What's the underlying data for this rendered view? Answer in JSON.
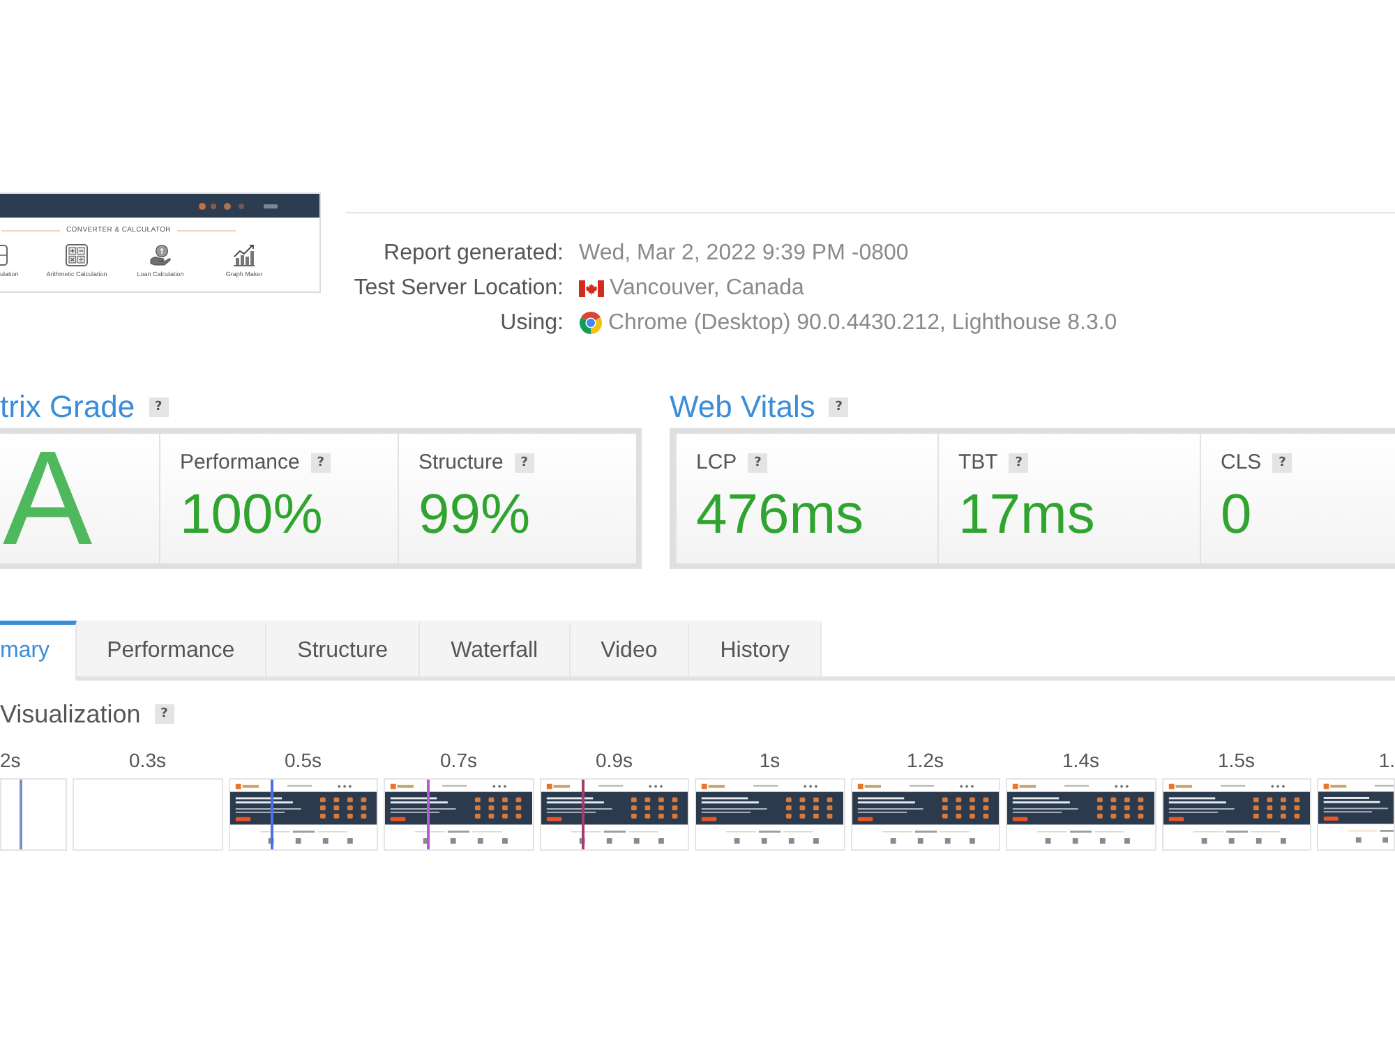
{
  "thumbnail": {
    "section_title": "CONVERTER & CALCULATOR",
    "tools": [
      {
        "kind": "box",
        "label": "ulation"
      },
      {
        "kind": "calculator",
        "label": "Arithmetic Calculation"
      },
      {
        "kind": "loan",
        "label": "Loan Calculation"
      },
      {
        "kind": "graph",
        "label": "Graph Maker"
      }
    ]
  },
  "report_info": [
    {
      "kind": "text",
      "label": "Report generated:",
      "value": "Wed, Mar 2, 2022 9:39 PM -0800"
    },
    {
      "kind": "location",
      "label": "Test Server Location:",
      "value": "Vancouver, Canada"
    },
    {
      "kind": "browser",
      "label": "Using:",
      "value": "Chrome (Desktop) 90.0.4430.212, Lighthouse 8.3.0"
    }
  ],
  "grade_panel": {
    "title": "trix Grade",
    "help": "?",
    "grade": "A",
    "metrics": [
      {
        "label": "Performance",
        "help": "?",
        "value": "100%"
      },
      {
        "label": "Structure",
        "help": "?",
        "value": "99%"
      }
    ]
  },
  "web_vitals": {
    "title": "Web Vitals",
    "help": "?",
    "metrics": [
      {
        "label": "LCP",
        "help": "?",
        "value": "476ms"
      },
      {
        "label": "TBT",
        "help": "?",
        "value": "17ms"
      },
      {
        "label": "CLS",
        "help": "?",
        "value": "0"
      }
    ]
  },
  "tabs": [
    {
      "label": "mary",
      "selected": true
    },
    {
      "label": "Performance",
      "selected": false
    },
    {
      "label": "Structure",
      "selected": false
    },
    {
      "label": "Waterfall",
      "selected": false
    },
    {
      "label": "Video",
      "selected": false
    },
    {
      "label": "History",
      "selected": false
    }
  ],
  "visualization": {
    "title": "Visualization",
    "help": "?",
    "frames": [
      {
        "time": "2s",
        "kind": "blank",
        "marker": {
          "color": "#7b8ec6"
        }
      },
      {
        "time": "0.3s",
        "kind": "blank"
      },
      {
        "time": "0.5s",
        "kind": "page",
        "marker": {
          "color": "#4a6fe6"
        }
      },
      {
        "time": "0.7s",
        "kind": "page",
        "marker": {
          "color": "#b25ad4"
        }
      },
      {
        "time": "0.9s",
        "kind": "page",
        "marker": {
          "color": "#a33d70"
        }
      },
      {
        "time": "1s",
        "kind": "page"
      },
      {
        "time": "1.2s",
        "kind": "page"
      },
      {
        "time": "1.4s",
        "kind": "page"
      },
      {
        "time": "1.5s",
        "kind": "page"
      },
      {
        "time": "1.",
        "kind": "page"
      }
    ]
  }
}
